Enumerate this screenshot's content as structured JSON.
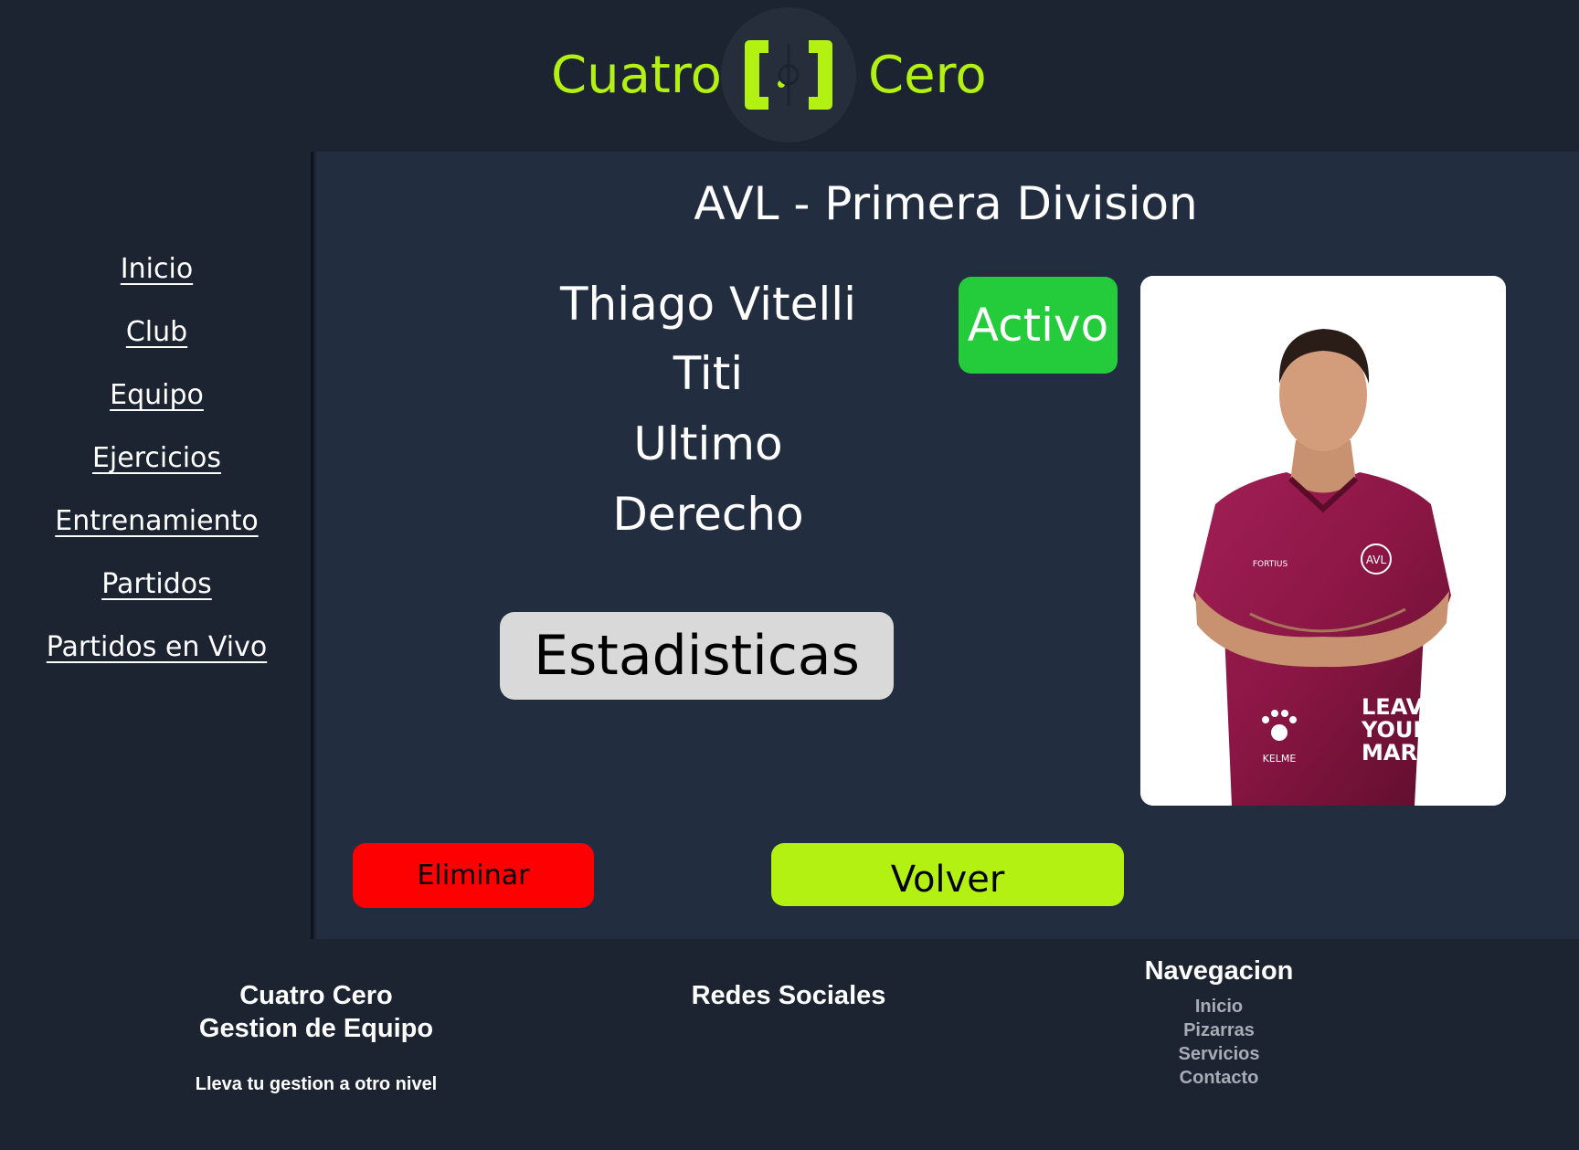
{
  "header": {
    "brand_left": "Cuatro",
    "brand_right": "Cero",
    "logo_icon": "bracket-logo-icon",
    "accent_color": "#b3f113"
  },
  "sidebar": {
    "items": [
      {
        "label": "Inicio"
      },
      {
        "label": "Club"
      },
      {
        "label": "Equipo"
      },
      {
        "label": "Ejercicios"
      },
      {
        "label": "Entrenamiento"
      },
      {
        "label": "Partidos"
      },
      {
        "label": "Partidos en Vivo"
      }
    ]
  },
  "main": {
    "team_title": "AVL - Primera Division",
    "player": {
      "name": "Thiago Vitelli",
      "nickname": "Titi",
      "position": "Ultimo",
      "foot": "Derecho"
    },
    "status": {
      "label": "Activo",
      "color": "#24cc3c"
    },
    "photo_jersey_text": [
      "LEAVE",
      "YOUR",
      "MARK",
      "KELME",
      "FORTIUS",
      "AVL"
    ],
    "buttons": {
      "stats_label": "Estadisticas",
      "delete_label": "Eliminar",
      "back_label": "Volver",
      "delete_color": "#fd0002",
      "back_color": "#b3f113"
    }
  },
  "footer": {
    "brand_line1": "Cuatro Cero",
    "brand_line2": "Gestion de Equipo",
    "tagline": "Lleva tu gestion a otro nivel",
    "social_title": "Redes Sociales",
    "nav_title": "Navegacion",
    "nav_links": [
      {
        "label": "Inicio"
      },
      {
        "label": "Pizarras"
      },
      {
        "label": "Servicios"
      },
      {
        "label": "Contacto"
      }
    ]
  }
}
